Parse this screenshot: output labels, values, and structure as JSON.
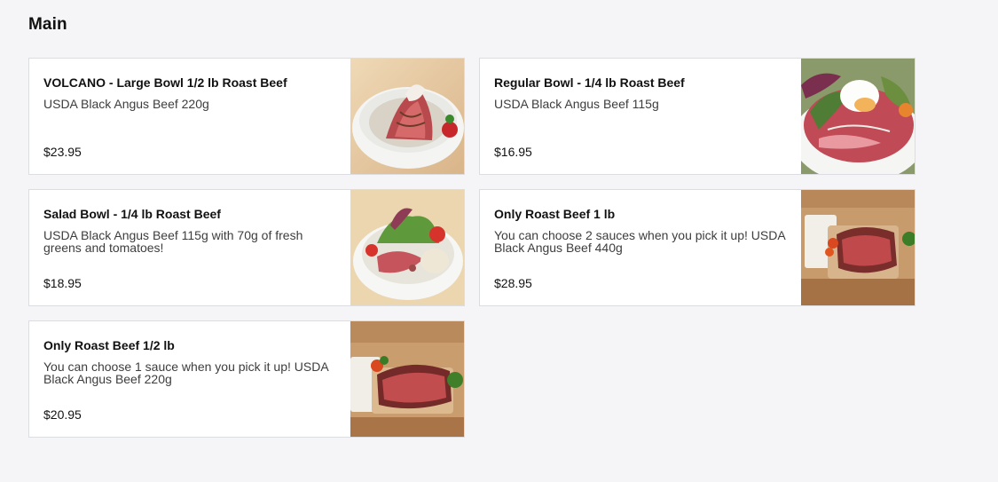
{
  "section": {
    "title": "Main"
  },
  "items": [
    {
      "title": "VOLCANO - Large Bowl 1/2 lb Roast Beef",
      "description": "USDA Black Angus Beef 220g",
      "price": "$23.95",
      "image_icon": "roast-beef-bowl-photo"
    },
    {
      "title": "Regular Bowl - 1/4 lb Roast Beef",
      "description": "USDA Black Angus Beef 115g",
      "price": "$16.95",
      "image_icon": "roast-beef-bowl-photo"
    },
    {
      "title": "Salad Bowl - 1/4 lb Roast Beef",
      "description": "USDA Black Angus Beef 115g with 70g of fresh greens and tomatoes!",
      "price": "$18.95",
      "image_icon": "salad-bowl-photo"
    },
    {
      "title": "Only Roast Beef 1 lb",
      "description": "You can choose 2 sauces when you pick it up! USDA Black Angus Beef 440g",
      "price": "$28.95",
      "image_icon": "roast-beef-board-photo"
    },
    {
      "title": "Only Roast Beef 1/2 lb",
      "description": "You can choose 1 sauce when you pick it up! USDA Black Angus Beef 220g",
      "price": "$20.95",
      "image_icon": "roast-beef-board-photo"
    }
  ]
}
